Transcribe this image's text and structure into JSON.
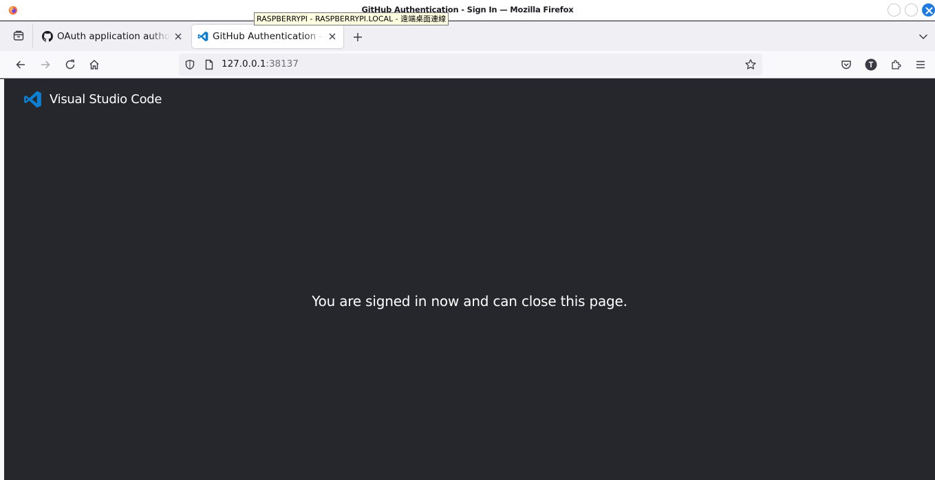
{
  "window": {
    "title": "GitHub Authentication - Sign In — Mozilla Firefox",
    "tooltip": "RASPBERRYPI - RASPBERRYPI.LOCAL - 遠端桌面連線"
  },
  "tabs": [
    {
      "label": "OAuth application authorized",
      "favicon": "github-icon",
      "active": false
    },
    {
      "label": "GitHub Authentication - Sign In",
      "favicon": "vscode-icon",
      "active": true
    }
  ],
  "urlbar": {
    "host": "127.0.0.1",
    "port": ":38137"
  },
  "page": {
    "brand": "Visual Studio Code",
    "message": "You are signed in now and can close this page."
  },
  "colors": {
    "page_background": "#25272c",
    "vscode_blue": "#0e7fd0",
    "accent": "#1f7ae0"
  }
}
